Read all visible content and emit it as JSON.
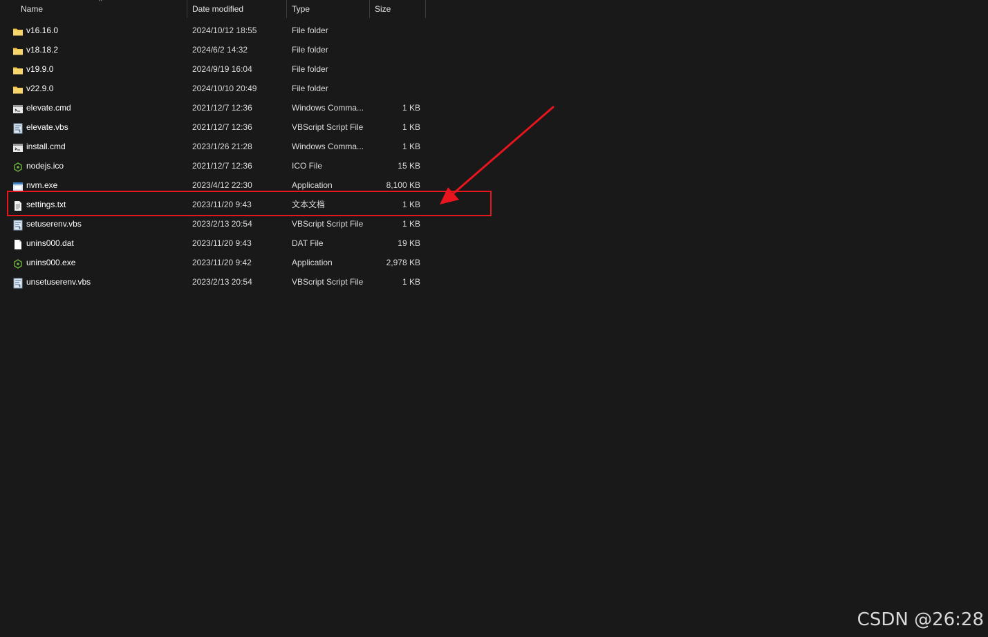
{
  "header": {
    "name_label": "Name",
    "date_label": "Date modified",
    "type_label": "Type",
    "size_label": "Size",
    "sort_indicator": "^"
  },
  "files": [
    {
      "name": "v16.16.0",
      "date": "2024/10/12 18:55",
      "type": "File folder",
      "size": "",
      "icon": "folder-icon"
    },
    {
      "name": "v18.18.2",
      "date": "2024/6/2 14:32",
      "type": "File folder",
      "size": "",
      "icon": "folder-icon"
    },
    {
      "name": "v19.9.0",
      "date": "2024/9/19 16:04",
      "type": "File folder",
      "size": "",
      "icon": "folder-icon"
    },
    {
      "name": "v22.9.0",
      "date": "2024/10/10 20:49",
      "type": "File folder",
      "size": "",
      "icon": "folder-icon"
    },
    {
      "name": "elevate.cmd",
      "date": "2021/12/7 12:36",
      "type": "Windows Comma...",
      "size": "1 KB",
      "icon": "cmd-file-icon"
    },
    {
      "name": "elevate.vbs",
      "date": "2021/12/7 12:36",
      "type": "VBScript Script File",
      "size": "1 KB",
      "icon": "vbs-file-icon"
    },
    {
      "name": "install.cmd",
      "date": "2023/1/26 21:28",
      "type": "Windows Comma...",
      "size": "1 KB",
      "icon": "cmd-file-icon"
    },
    {
      "name": "nodejs.ico",
      "date": "2021/12/7 12:36",
      "type": "ICO File",
      "size": "15 KB",
      "icon": "nodejs-icon"
    },
    {
      "name": "nvm.exe",
      "date": "2023/4/12 22:30",
      "type": "Application",
      "size": "8,100 KB",
      "icon": "exe-window-icon"
    },
    {
      "name": "settings.txt",
      "date": "2023/11/20 9:43",
      "type": "文本文档",
      "size": "1 KB",
      "icon": "text-file-icon"
    },
    {
      "name": "setuserenv.vbs",
      "date": "2023/2/13 20:54",
      "type": "VBScript Script File",
      "size": "1 KB",
      "icon": "vbs-file-icon"
    },
    {
      "name": "unins000.dat",
      "date": "2023/11/20 9:43",
      "type": "DAT File",
      "size": "19 KB",
      "icon": "blank-file-icon"
    },
    {
      "name": "unins000.exe",
      "date": "2023/11/20 9:42",
      "type": "Application",
      "size": "2,978 KB",
      "icon": "nodejs-icon"
    },
    {
      "name": "unsetuserenv.vbs",
      "date": "2023/2/13 20:54",
      "type": "VBScript Script File",
      "size": "1 KB",
      "icon": "vbs-file-icon"
    }
  ],
  "annotation": {
    "highlighted_file": "settings.txt",
    "color": "#e8141e"
  },
  "watermark": "CSDN @26:28",
  "colors": {
    "background": "#191919",
    "folder": "#f4c54a",
    "nodejs": "#6bb342"
  }
}
